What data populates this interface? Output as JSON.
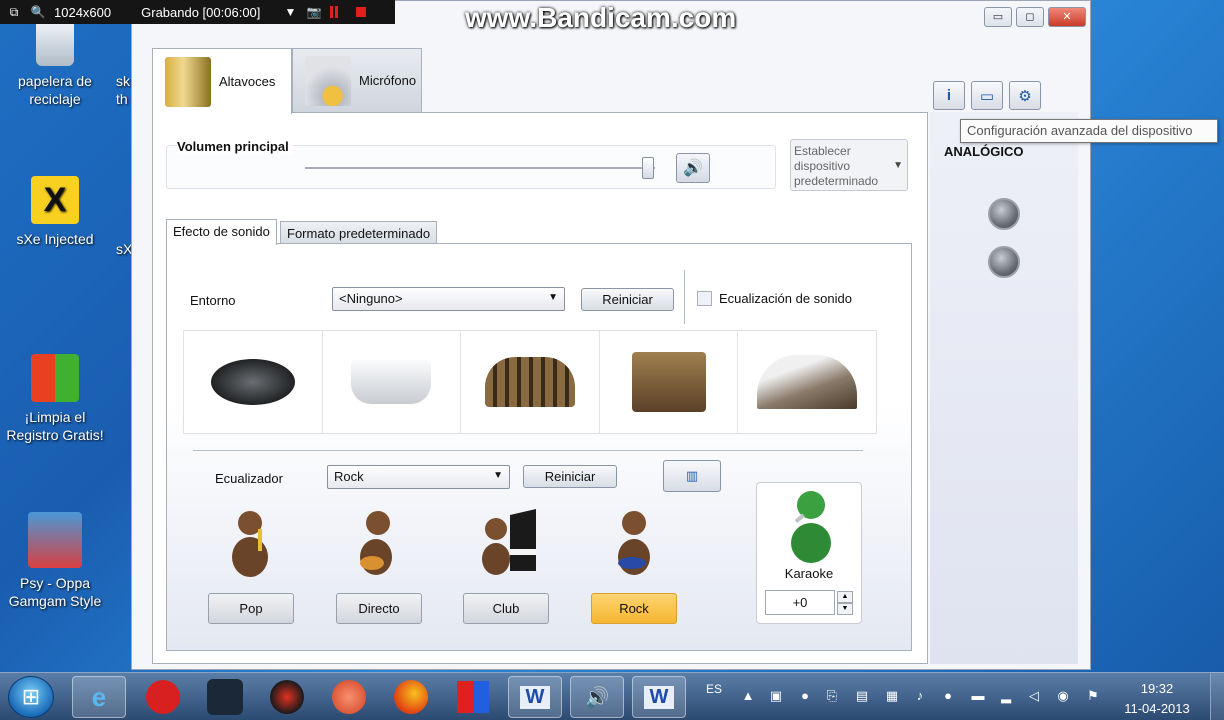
{
  "recorder": {
    "resolution": "1024x600",
    "status": "Grabando [00:06:00]"
  },
  "watermark": "www.Bandicam.com",
  "desktop": {
    "icons": [
      {
        "label": "papelera de reciclaje"
      },
      {
        "label": "sXe Injected"
      },
      {
        "label": "¡Limpia el Registro Gratis!"
      },
      {
        "label": "Psy - Oppa Gamgam Style"
      }
    ],
    "partial": [
      "sk th",
      "sX"
    ]
  },
  "window": {
    "tabs": [
      {
        "label": "Altavoces"
      },
      {
        "label": "Micrófono"
      }
    ],
    "volume": {
      "label": "Volumen principal",
      "level": 0.95
    },
    "default_device": "Establecer dispositivo predeterminado",
    "subtabs": [
      {
        "label": "Efecto de sonido"
      },
      {
        "label": "Formato predeterminado"
      }
    ],
    "environment": {
      "label": "Entorno",
      "value": "<Ninguno>",
      "reset": "Reiniciar",
      "eq_checkbox": "Ecualización de sonido",
      "presets": [
        "sewer-cover-icon",
        "bathtub-icon",
        "colosseum-icon",
        "stone-room-icon",
        "opera-house-icon"
      ]
    },
    "equalizer": {
      "label": "Ecualizador",
      "value": "Rock",
      "reset": "Reiniciar",
      "presets": [
        {
          "label": "Pop",
          "selected": false
        },
        {
          "label": "Directo",
          "selected": false
        },
        {
          "label": "Club",
          "selected": false
        },
        {
          "label": "Rock",
          "selected": true
        }
      ]
    },
    "karaoke": {
      "label": "Karaoke",
      "value": "+0"
    },
    "right_panel": {
      "tooltip": "Configuración avanzada del dispositivo",
      "section": "ANALÓGICO"
    }
  },
  "taskbar": {
    "lang": "ES",
    "time": "19:32",
    "date": "11-04-2013"
  },
  "colors": {
    "selected_preset": "#f5b730",
    "accent": "#1e5aa8"
  }
}
